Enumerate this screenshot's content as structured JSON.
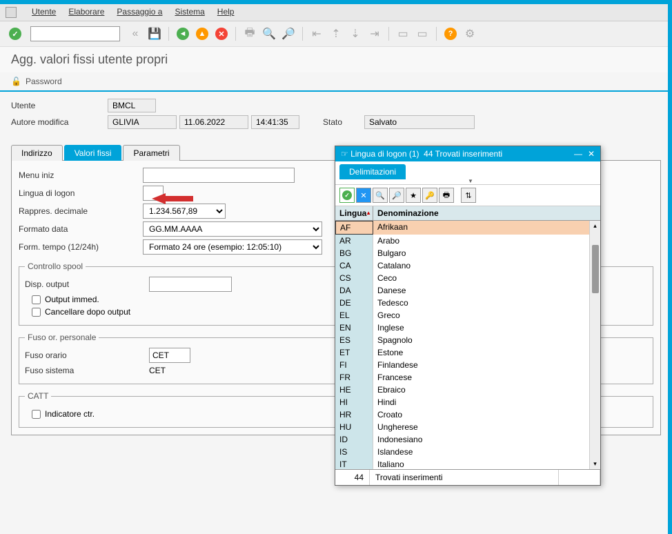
{
  "menu": {
    "utente": "Utente",
    "elaborare": "Elaborare",
    "passaggio": "Passaggio a",
    "sistema": "Sistema",
    "help": "Help"
  },
  "title": "Agg. valori fissi utente propri",
  "password_label": "Password",
  "header": {
    "utente_label": "Utente",
    "utente_val": "BMCL",
    "autore_label": "Autore modifica",
    "autore_val": "GLIVIA",
    "date_val": "11.06.2022",
    "time_val": "14:41:35",
    "stato_label": "Stato",
    "stato_val": "Salvato"
  },
  "tabs": {
    "indirizzo": "Indirizzo",
    "valori": "Valori fissi",
    "parametri": "Parametri"
  },
  "form": {
    "menu_iniz": "Menu iniz",
    "lingua": "Lingua di logon",
    "decimale_label": "Rappres. decimale",
    "decimale_val": "1.234.567,89",
    "data_label": "Formato data",
    "data_val": "GG.MM.AAAA",
    "tempo_label": "Form. tempo (12/24h)",
    "tempo_val": "Formato 24 ore (esempio: 12:05:10)"
  },
  "spool": {
    "legend": "Controllo spool",
    "output_label": "Disp. output",
    "immed": "Output immed.",
    "cancel": "Cancellare dopo output"
  },
  "fuso": {
    "legend": "Fuso or. personale",
    "orario_label": "Fuso orario",
    "orario_val": "CET",
    "sistema_label": "Fuso sistema",
    "sistema_val": "CET"
  },
  "catt": {
    "legend": "CATT",
    "indicatore": "Indicatore ctr."
  },
  "popup": {
    "title_left": "Lingua di logon (1)",
    "title_right": "44 Trovati inserimenti",
    "tab": "Delimitazioni",
    "col1": "Lingua",
    "col2": "Denominazione",
    "rows": [
      {
        "c": "AF",
        "n": "Afrikaan"
      },
      {
        "c": "AR",
        "n": "Arabo"
      },
      {
        "c": "BG",
        "n": "Bulgaro"
      },
      {
        "c": "CA",
        "n": "Catalano"
      },
      {
        "c": "CS",
        "n": "Ceco"
      },
      {
        "c": "DA",
        "n": "Danese"
      },
      {
        "c": "DE",
        "n": "Tedesco"
      },
      {
        "c": "EL",
        "n": "Greco"
      },
      {
        "c": "EN",
        "n": "Inglese"
      },
      {
        "c": "ES",
        "n": "Spagnolo"
      },
      {
        "c": "ET",
        "n": "Estone"
      },
      {
        "c": "FI",
        "n": "Finlandese"
      },
      {
        "c": "FR",
        "n": "Francese"
      },
      {
        "c": "HE",
        "n": "Ebraico"
      },
      {
        "c": "HI",
        "n": "Hindi"
      },
      {
        "c": "HR",
        "n": "Croato"
      },
      {
        "c": "HU",
        "n": "Ungherese"
      },
      {
        "c": "ID",
        "n": "Indonesiano"
      },
      {
        "c": "IS",
        "n": "Islandese"
      },
      {
        "c": "IT",
        "n": "Italiano"
      }
    ],
    "status_count": "44",
    "status_txt": "Trovati inserimenti"
  }
}
